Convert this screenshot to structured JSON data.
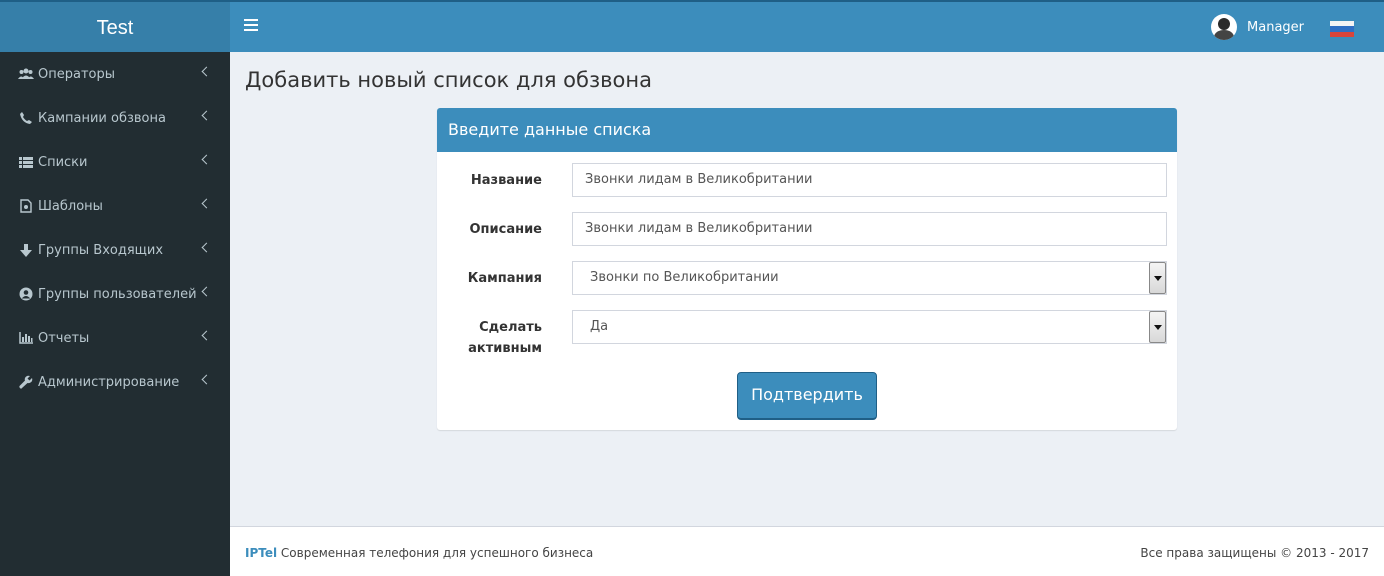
{
  "app": {
    "title": "Test"
  },
  "header": {
    "user_name": "Manager"
  },
  "sidebar": {
    "items": [
      {
        "label": "Операторы"
      },
      {
        "label": "Кампании обзвона"
      },
      {
        "label": "Списки"
      },
      {
        "label": "Шаблоны"
      },
      {
        "label": "Группы Входящих"
      },
      {
        "label": "Группы пользователей"
      },
      {
        "label": "Отчеты"
      },
      {
        "label": "Администрирование"
      }
    ]
  },
  "page": {
    "title": "Добавить новый список для обзвона"
  },
  "form": {
    "header": "Введите данные списка",
    "name_label": "Название",
    "name_value": "Звонки лидам в Великобритании",
    "description_label": "Описание",
    "description_value": "Звонки лидам в Великобритании",
    "campaign_label": "Кампания",
    "campaign_value": "Звонки по Великобритании",
    "active_label_line1": "Сделать",
    "active_label_line2": "активным",
    "active_value": "Да",
    "submit_label": "Подтвердить"
  },
  "footer": {
    "brand": "IPTel",
    "tagline": " Современная телефония для успешного бизнеса",
    "copyright": "Все права защищены © 2013 - 2017"
  },
  "colors": {
    "primary": "#3c8dbc",
    "primary_dark": "#367fa9",
    "sidebar_bg": "#222d32",
    "sidebar_text": "#b8c7ce",
    "content_bg": "#ecf0f5"
  },
  "icons": {
    "menu": "hamburger-icon",
    "operators": "users-icon",
    "campaigns": "phone-icon",
    "lists": "list-icon",
    "templates": "file-icon",
    "inbound": "arrow-down-icon",
    "user_groups": "user-circle-icon",
    "reports": "bar-chart-icon",
    "admin": "wrench-icon",
    "language": "flag-icon"
  }
}
